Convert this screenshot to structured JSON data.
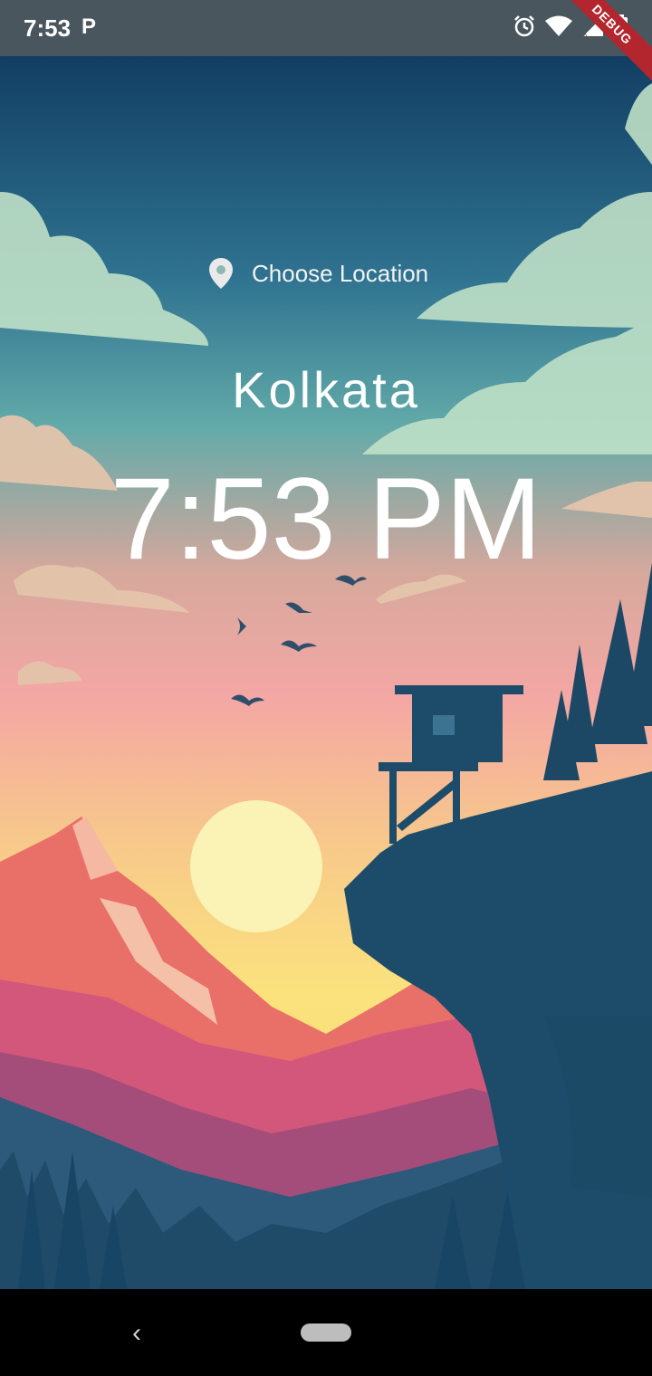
{
  "status_bar": {
    "time": "7:53",
    "notification_glyph": "P",
    "icons": [
      "alarm-icon",
      "wifi-icon",
      "signal-icon",
      "battery-charging-icon"
    ]
  },
  "debug_banner": {
    "label": "DEBUG"
  },
  "location": {
    "button_label": "Choose Location",
    "icon": "location-pin-icon",
    "city": "Kolkata",
    "time": "7:53 PM"
  },
  "nav_bar": {
    "back_icon": "back-chevron-icon",
    "home_icon": "home-pill-icon"
  }
}
